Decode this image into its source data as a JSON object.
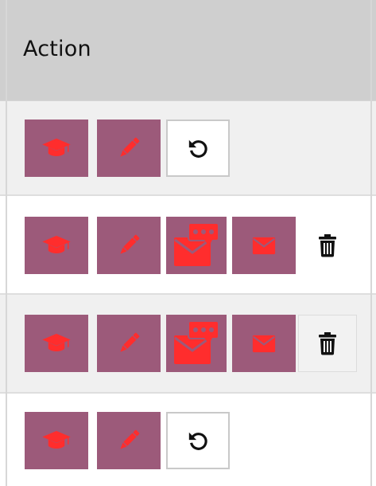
{
  "header": {
    "title": "Action"
  },
  "rows": [
    {
      "actions": [
        "graduation-cap-icon",
        "pencil-icon",
        "undo-icon"
      ]
    },
    {
      "actions": [
        "graduation-cap-icon",
        "pencil-icon",
        "mail-comment-icon",
        "envelope-icon",
        "trash-icon"
      ]
    },
    {
      "actions": [
        "graduation-cap-icon",
        "pencil-icon",
        "mail-comment-icon",
        "envelope-icon",
        "trash-icon"
      ]
    },
    {
      "actions": [
        "graduation-cap-icon",
        "pencil-icon",
        "undo-icon"
      ]
    }
  ],
  "colors": {
    "button_bg": "#9c5a7a",
    "icon_red": "#ff2d2d",
    "header_bg": "#cfcfcf",
    "row_alt_bg": "#f0f0f0"
  }
}
